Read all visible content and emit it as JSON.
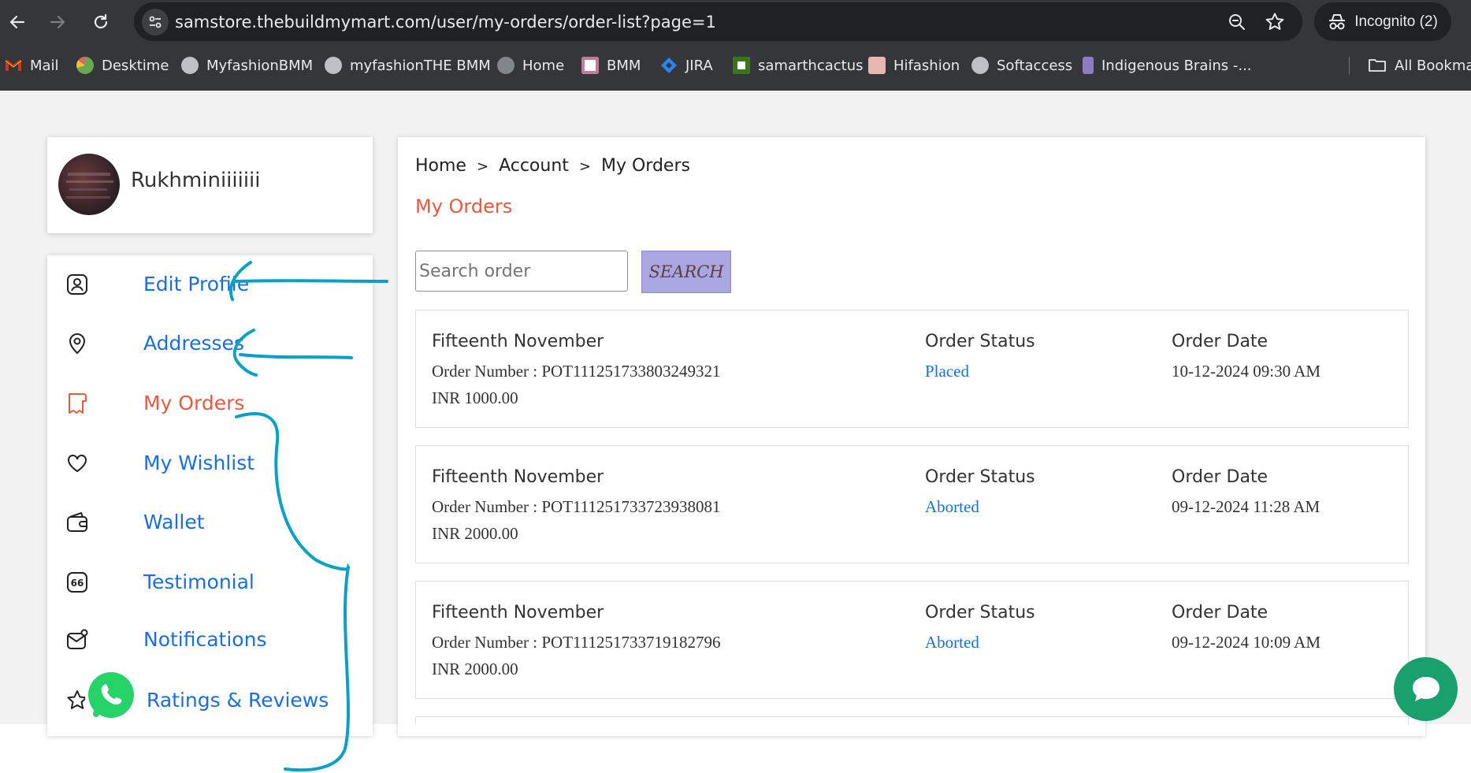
{
  "browser": {
    "url": "samstore.thebuildmymart.com/user/my-orders/order-list?page=1",
    "incognito_label": "Incognito (2)",
    "bookmarks": [
      {
        "label": "Mail",
        "icon": "gmail-icon",
        "color": "#d93025"
      },
      {
        "label": "Desktime",
        "icon": "desktime-icon",
        "color": "#6aa84f"
      },
      {
        "label": "MyfashionBMM",
        "icon": "globe-icon",
        "color": "#bdc1c6"
      },
      {
        "label": "myfashionTHE BMM",
        "icon": "globe-icon",
        "color": "#bdc1c6"
      },
      {
        "label": "Home",
        "icon": "globe-icon",
        "color": "#9aa0a6"
      },
      {
        "label": "BMM",
        "icon": "bmm-icon",
        "color": "#c27ba0"
      },
      {
        "label": "JIRA",
        "icon": "jira-icon",
        "color": "#2684ff"
      },
      {
        "label": "samarthcactus",
        "icon": "cactus-icon",
        "color": "#38761d"
      },
      {
        "label": "Hifashion",
        "icon": "hifashion-icon",
        "color": "#e6b8af"
      },
      {
        "label": "Softaccess",
        "icon": "globe-icon",
        "color": "#bdc1c6"
      },
      {
        "label": "Indigenous Brains -...",
        "icon": "indigenous-icon",
        "color": "#8e7cc3"
      }
    ],
    "all_bookmarks_label": "All Bookmar"
  },
  "profile": {
    "name": "Rukhminiiiiiii"
  },
  "sidebar": {
    "items": [
      {
        "label": "Edit Profile",
        "icon": "profile-icon"
      },
      {
        "label": "Addresses",
        "icon": "location-pin-icon"
      },
      {
        "label": "My Orders",
        "icon": "receipt-icon",
        "active": true
      },
      {
        "label": "My Wishlist",
        "icon": "heart-icon"
      },
      {
        "label": "Wallet",
        "icon": "wallet-icon"
      },
      {
        "label": "Testimonial",
        "icon": "quote-icon"
      },
      {
        "label": "Notifications",
        "icon": "mail-notification-icon"
      },
      {
        "label": "Ratings & Reviews",
        "icon": "star-icon"
      }
    ]
  },
  "breadcrumb": {
    "home": "Home",
    "sep": ">",
    "account": "Account",
    "current": "My Orders"
  },
  "main": {
    "title": "My Orders"
  },
  "search": {
    "placeholder": "Search order",
    "button": "SEARCH"
  },
  "orders": [
    {
      "title": "Fifteenth November",
      "number": "Order Number : POT111251733803249321",
      "amount": "INR 1000.00",
      "status_label": "Order Status",
      "status": "Placed",
      "date_label": "Order Date",
      "date": "10-12-2024 09:30 AM"
    },
    {
      "title": "Fifteenth November",
      "number": "Order Number : POT111251733723938081",
      "amount": "INR 2000.00",
      "status_label": "Order Status",
      "status": "Aborted",
      "date_label": "Order Date",
      "date": "09-12-2024 11:28 AM"
    },
    {
      "title": "Fifteenth November",
      "number": "Order Number : POT111251733719182796",
      "amount": "INR 2000.00",
      "status_label": "Order Status",
      "status": "Aborted",
      "date_label": "Order Date",
      "date": "09-12-2024 10:09 AM"
    }
  ],
  "colors": {
    "accent": "#e85a3c",
    "link": "#1a6fe0",
    "annotation": "#0aa0c8",
    "whatsapp": "#25d366",
    "chat": "#1aa06d"
  }
}
